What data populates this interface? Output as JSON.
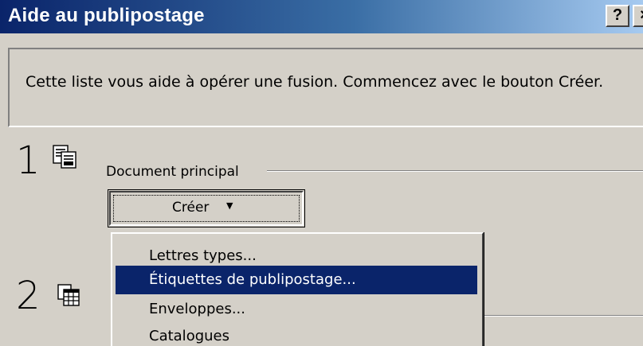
{
  "window": {
    "title": "Aide au publipostage",
    "help_label": "?",
    "close_label": "×"
  },
  "info": {
    "text": "Cette liste vous aide à opérer une fusion. Commencez avec le bouton Créer."
  },
  "steps": [
    {
      "number": "1",
      "label": "Document principal",
      "icon": "main-document-icon"
    },
    {
      "number": "2",
      "icon": "data-source-icon"
    }
  ],
  "create_button": {
    "label": "Créer",
    "arrow": "▼"
  },
  "menu": {
    "items": [
      {
        "label": "Lettres types...",
        "selected": false
      },
      {
        "label": "Étiquettes de publipostage...",
        "selected": true
      },
      {
        "label": "Enveloppes...",
        "selected": false
      },
      {
        "label": "Catalogues",
        "selected": false
      }
    ]
  },
  "colors": {
    "titlebar_start": "#0a246a",
    "titlebar_end": "#a6caf0",
    "dialog_bg": "#d4d0c8",
    "selection": "#0a246a"
  }
}
